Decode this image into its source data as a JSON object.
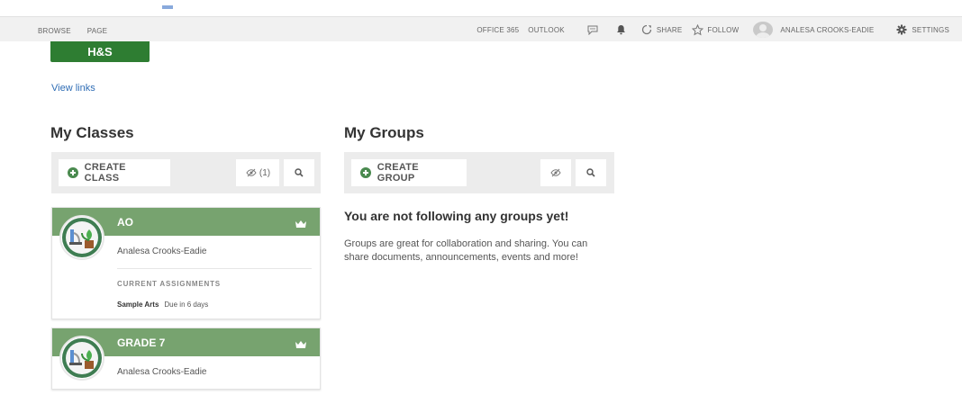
{
  "topbar": {
    "left_items": [
      "BROWSE",
      "PAGE"
    ],
    "office365": "OFFICE 365",
    "outlook": "OUTLOOK",
    "share": "SHARE",
    "follow": "FOLLOW",
    "user_name": "ANALESA CROOKS-EADIE",
    "settings": "SETTINGS"
  },
  "quick_link": {
    "label": "H&S"
  },
  "view_links": "View links",
  "my_classes": {
    "title": "My Classes",
    "create_label": "CREATE CLASS",
    "hidden_count": "(1)",
    "classes": [
      {
        "name": "AO",
        "owner": "Analesa Crooks-Eadie",
        "assignments_title": "CURRENT ASSIGNMENTS",
        "assignment_name": "Sample Arts",
        "assignment_due": "Due in 6 days"
      },
      {
        "name": "GRADE 7",
        "owner": "Analesa Crooks-Eadie"
      }
    ]
  },
  "my_groups": {
    "title": "My Groups",
    "create_label": "CREATE GROUP",
    "empty_heading": "You are not following any groups yet!",
    "empty_text": "Groups are great for collaboration and sharing. You can share documents, announcements, events and more!"
  },
  "colors": {
    "brand_green": "#2e7d32",
    "card_header": "#77a36f",
    "link_blue": "#2f6db5"
  }
}
